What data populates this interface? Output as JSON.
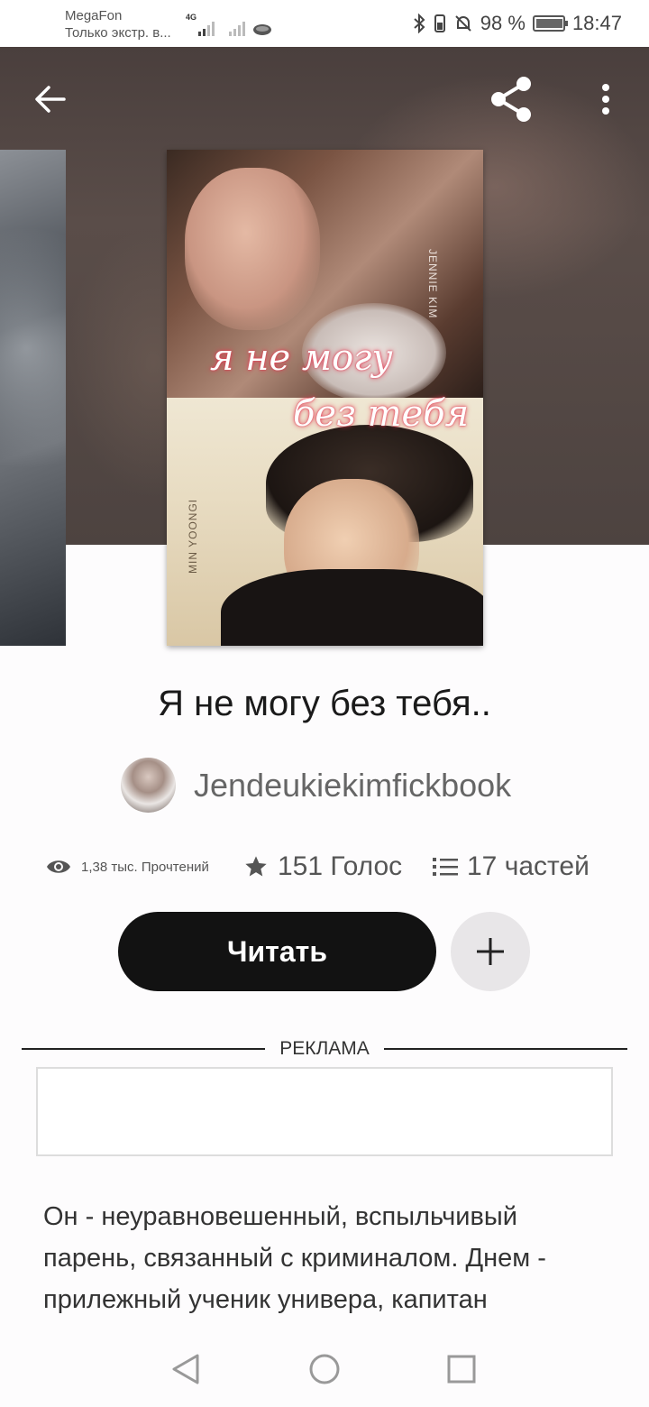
{
  "status_bar": {
    "carrier": "MegaFon",
    "carrier_sub": "Только экстр. в...",
    "network": "4G",
    "battery": "98 %",
    "time": "18:47"
  },
  "header": {
    "back_icon": "arrow-left-icon",
    "share_icon": "share-icon",
    "more_icon": "more-vertical-icon"
  },
  "cover": {
    "script_line1": "я не могу",
    "script_line2": "без тебя",
    "name_top": "JENNIE KIM",
    "name_bottom": "MIN YOONGI"
  },
  "story": {
    "title": "Я не могу без тебя..",
    "author": "Jendeukiekimfickbook",
    "reads": "1,38 тыс. Прочтений",
    "votes": "151 Голос",
    "parts": "17 частей"
  },
  "actions": {
    "read_label": "Читать",
    "add_icon": "plus-icon"
  },
  "ad": {
    "label": "РЕКЛАМА"
  },
  "description": "Он - неуравновешенный, вспыльчивый парень, связанный с криминалом. Днем - прилежный ученик универа, капитан",
  "colors": {
    "primary_button": "#121212",
    "secondary_button": "#e8e6e8",
    "script_glow": "#e23a52"
  }
}
